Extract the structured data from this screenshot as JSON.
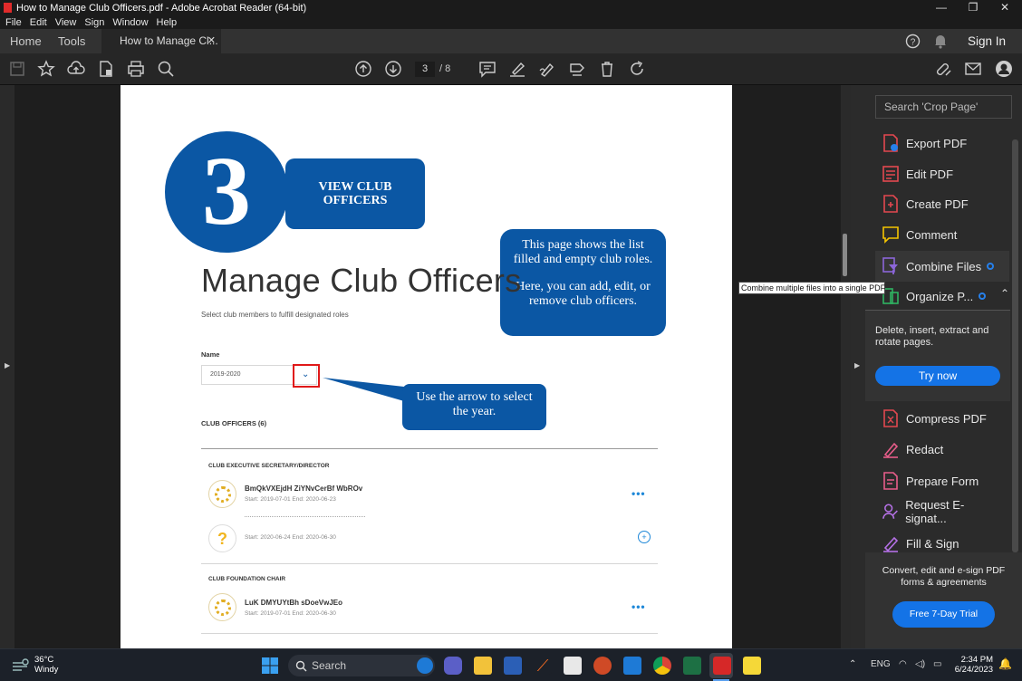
{
  "window": {
    "title": "How to Manage Club Officers.pdf - Adobe Acrobat Reader (64-bit)"
  },
  "menu": [
    "File",
    "Edit",
    "View",
    "Sign",
    "Window",
    "Help"
  ],
  "tabs": {
    "home": "Home",
    "tools": "Tools",
    "doc": "How to Manage Cl...",
    "close": "✕",
    "signin": "Sign In"
  },
  "toolbar": {
    "page_current": "3",
    "page_total": "/ 8"
  },
  "page": {
    "number": "3",
    "view_label": "VIEW CLUB OFFICERS",
    "info_bubble_1": "This page shows the list filled and empty club roles.",
    "info_bubble_2": "Here, you can add, edit, or remove club officers.",
    "arrow_bubble": "Use the arrow to select the year.",
    "title": "Manage Club Officers",
    "subtitle": "Select club members to fulfill designated roles",
    "name_label": "Name",
    "year_value": "2019-2020",
    "year_arrow": "⌄",
    "officers_header": "CLUB OFFICERS (6)",
    "qmark": "?",
    "more": "•••",
    "plus": "+",
    "sections": [
      {
        "title": "CLUB EXECUTIVE SECRETARY/DIRECTOR",
        "entries": [
          {
            "name": "BmQkVXEjdH ZiYNvCerBf WbROv",
            "dates": "Start: 2019-07-01    End: 2020-06-23"
          },
          {
            "name": "",
            "dates": "Start: 2020-06-24    End: 2020-06-30"
          }
        ]
      },
      {
        "title": "CLUB FOUNDATION CHAIR",
        "entries": [
          {
            "name": "LuK DMYUYtBh sDoeVwJEo",
            "dates": "Start: 2019-07-01    End: 2020-06-30"
          }
        ]
      }
    ]
  },
  "panel": {
    "search_placeholder": "Search 'Crop Page'",
    "items": [
      {
        "label": "Export PDF",
        "icon": "export-pdf-icon",
        "color": "#e34850"
      },
      {
        "label": "Edit PDF",
        "icon": "edit-pdf-icon",
        "color": "#e34850"
      },
      {
        "label": "Create PDF",
        "icon": "create-pdf-icon",
        "color": "#e34850"
      },
      {
        "label": "Comment",
        "icon": "comment-icon",
        "color": "#f5c400"
      },
      {
        "label": "Combine Files",
        "icon": "combine-files-icon",
        "color": "#8c66d9"
      },
      {
        "label": "Organize P...",
        "icon": "organize-pages-icon",
        "color": "#2fb362"
      },
      {
        "label": "Compress PDF",
        "icon": "compress-pdf-icon",
        "color": "#e34850"
      },
      {
        "label": "Redact",
        "icon": "redact-icon",
        "color": "#e85d8a"
      },
      {
        "label": "Prepare Form",
        "icon": "prepare-form-icon",
        "color": "#e85d8a"
      },
      {
        "label": "Request E-signat...",
        "icon": "request-esign-icon",
        "color": "#b571e6"
      },
      {
        "label": "Fill & Sign",
        "icon": "fill-sign-icon",
        "color": "#b571e6"
      }
    ],
    "organize_desc": "Delete, insert, extract and rotate pages.",
    "try_now": "Try now",
    "promo_text": "Convert, edit and e-sign PDF forms & agreements",
    "trial_button": "Free 7-Day Trial",
    "tooltip": "Combine multiple files into a single PDF"
  },
  "taskbar": {
    "temp": "36°C",
    "weather": "Windy",
    "search": "Search",
    "lang": "ENG",
    "time": "2:34 PM",
    "date": "6/24/2023"
  }
}
